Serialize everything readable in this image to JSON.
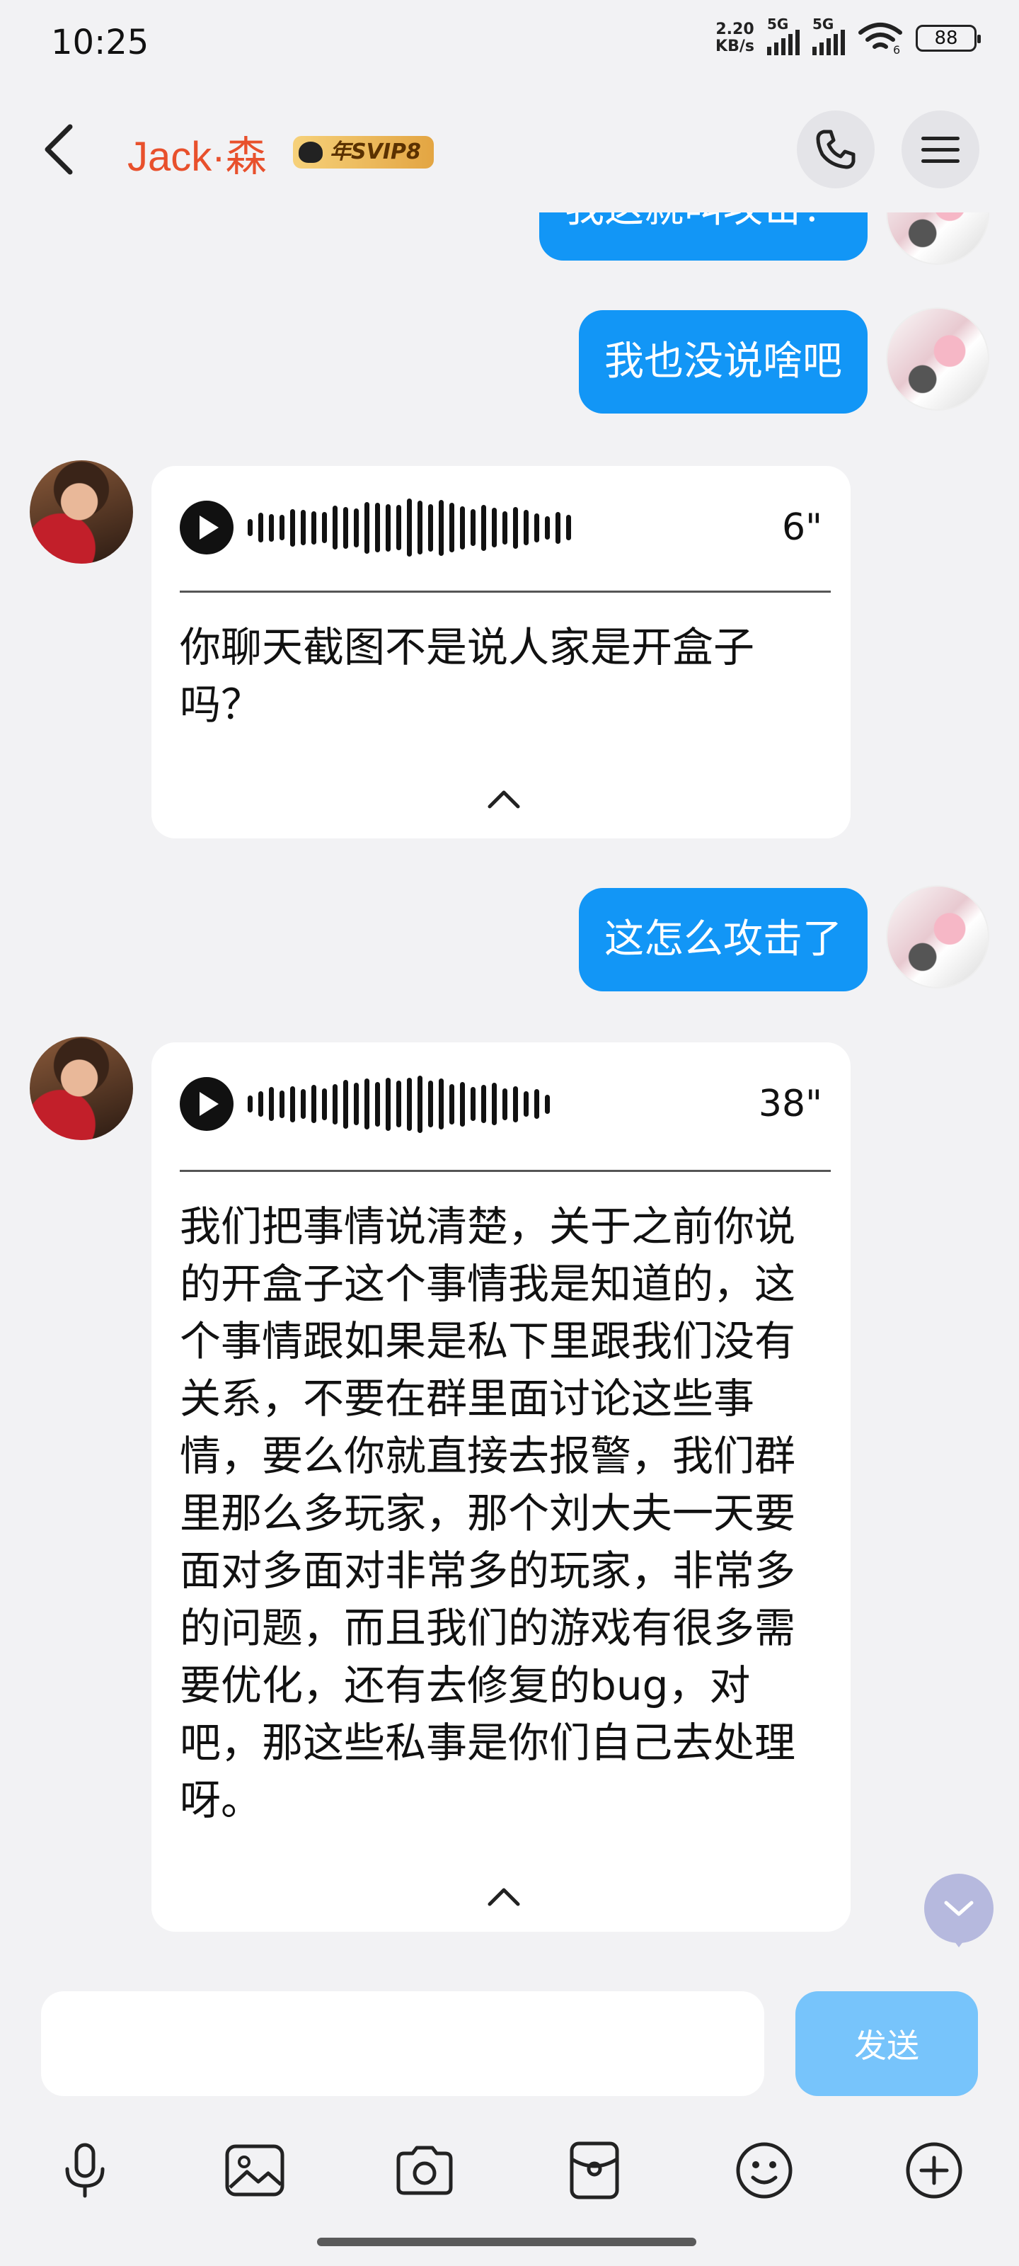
{
  "status_bar": {
    "time": "10:25",
    "net_speed_value": "2.20",
    "net_speed_unit": "KB/s",
    "sim1_type": "5G",
    "sim2_type": "5G",
    "wifi_label": "6",
    "battery": "88"
  },
  "header": {
    "contact_name": "Jack·森",
    "badge": "年SVIP8"
  },
  "messages": [
    {
      "type": "text",
      "side": "right",
      "text": "我这就叫攻击？"
    },
    {
      "type": "text",
      "side": "right",
      "text": "我也没说啥吧"
    },
    {
      "type": "voice",
      "side": "left",
      "duration": "6\"",
      "transcript": "你聊天截图不是说人家是开盒子吗？"
    },
    {
      "type": "text",
      "side": "right",
      "text": "这怎么攻击了"
    },
    {
      "type": "voice",
      "side": "left",
      "duration": "38\"",
      "transcript": "我们把事情说清楚，关于之前你说的开盒子这个事情我是知道的，这个事情跟如果是私下里跟我们没有关系，不要在群里面讨论这些事情，要么你就直接去报警，我们群里那么多玩家，那个刘大夫一天要面对多面对非常多的玩家，非常多的问题，而且我们的游戏有很多需要优化，还有去修复的bug，对吧，那这些私事是你们自己去处理呀。"
    }
  ],
  "input": {
    "value": "",
    "send_label": "发送"
  },
  "toolbar": {
    "icons": [
      "microphone-icon",
      "image-icon",
      "camera-icon",
      "red-packet-icon",
      "emoji-icon",
      "plus-icon"
    ]
  },
  "colors": {
    "accent_name": "#e8502c",
    "bubble_out": "#1296f6",
    "send_disabled": "#77c4fb",
    "background": "#f2f2f4"
  }
}
